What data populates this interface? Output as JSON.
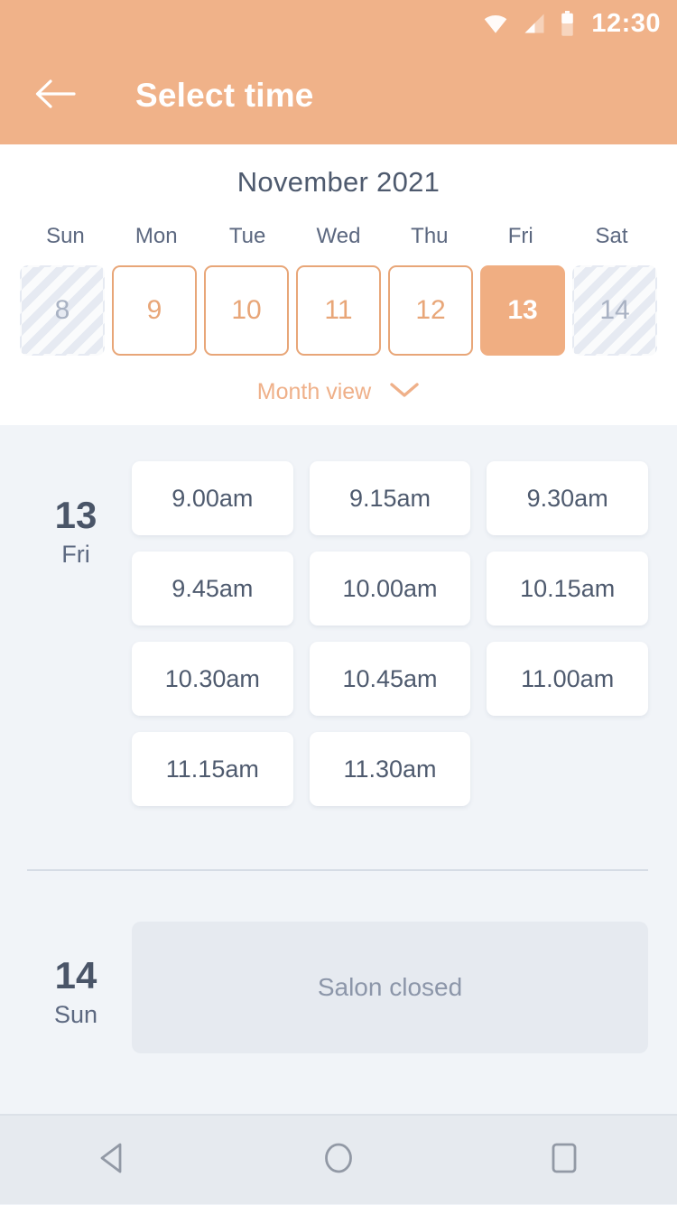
{
  "status_bar": {
    "time": "12:30",
    "icons": [
      "wifi-icon",
      "cellular-signal-icon",
      "battery-icon"
    ]
  },
  "app_bar": {
    "back_icon": "arrow-left-icon",
    "title": "Select time"
  },
  "calendar": {
    "month_title": "November 2021",
    "weekdays": [
      "Sun",
      "Mon",
      "Tue",
      "Wed",
      "Thu",
      "Fri",
      "Sat"
    ],
    "days": [
      {
        "number": "8",
        "state": "disabled"
      },
      {
        "number": "9",
        "state": "available"
      },
      {
        "number": "10",
        "state": "available"
      },
      {
        "number": "11",
        "state": "available"
      },
      {
        "number": "12",
        "state": "available"
      },
      {
        "number": "13",
        "state": "selected"
      },
      {
        "number": "14",
        "state": "disabled"
      }
    ],
    "month_view_label": "Month view",
    "month_view_icon": "chevron-down-icon"
  },
  "schedule": [
    {
      "day_number": "13",
      "day_name": "Fri",
      "slots": [
        "9.00am",
        "9.15am",
        "9.30am",
        "9.45am",
        "10.00am",
        "10.15am",
        "10.30am",
        "10.45am",
        "11.00am",
        "11.15am",
        "11.30am"
      ]
    },
    {
      "day_number": "14",
      "day_name": "Sun",
      "closed_message": "Salon closed"
    }
  ],
  "nav_bar": {
    "back_icon": "triangle-back-icon",
    "home_icon": "circle-home-icon",
    "recents_icon": "square-recents-icon"
  },
  "colors": {
    "accent": "#F0B289",
    "accent_border": "#E8A678",
    "selected_day": "#F0AE82",
    "text_dark": "#4A5568",
    "text_muted": "#8C96A9",
    "background": "#F1F4F8",
    "card": "#FFFFFF",
    "closed_card": "#E6EAF0"
  }
}
